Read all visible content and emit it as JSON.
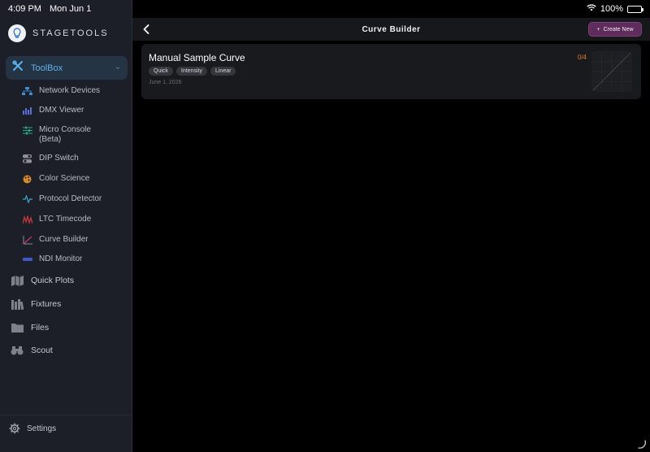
{
  "status": {
    "time": "4:09 PM",
    "date": "Mon Jun 1",
    "battery": "100%"
  },
  "brand": {
    "name": "STAGETOOLS"
  },
  "sidebar": {
    "toolbox": {
      "label": "ToolBox"
    },
    "subitems": [
      {
        "label": "Network Devices",
        "icon": "network-icon",
        "color": "#3a8fd6"
      },
      {
        "label": "DMX Viewer",
        "icon": "dmx-icon",
        "color": "#5b6fd6"
      },
      {
        "label": "Micro Console (Beta)",
        "icon": "sliders-icon",
        "color": "#2aa88a"
      },
      {
        "label": "DIP Switch",
        "icon": "dip-switch-icon",
        "color": "#8e8f95"
      },
      {
        "label": "Color Science",
        "icon": "palette-icon",
        "color": "#d8892b"
      },
      {
        "label": "Protocol Detector",
        "icon": "waveform-icon",
        "color": "#3fa6c8"
      },
      {
        "label": "LTC Timecode",
        "icon": "timecode-icon",
        "color": "#c43a3a"
      },
      {
        "label": "Curve Builder",
        "icon": "curve-icon",
        "color": "#c43a6b"
      },
      {
        "label": "NDI Monitor",
        "icon": "ndi-icon",
        "color": "#4057c9"
      }
    ],
    "main_items": [
      {
        "label": "Quick Plots",
        "icon": "map-icon"
      },
      {
        "label": "Fixtures",
        "icon": "books-icon"
      },
      {
        "label": "Files",
        "icon": "folder-icon"
      },
      {
        "label": "Scout",
        "icon": "binoculars-icon"
      }
    ],
    "settings": {
      "label": "Settings"
    }
  },
  "navbar": {
    "title": "Curve Builder",
    "create_label": "Create New"
  },
  "card": {
    "title": "Manual Sample Curve",
    "tags": [
      "Quick",
      "Intensity",
      "Linear"
    ],
    "date": "June 1, 2026",
    "count": "0/4"
  },
  "colors": {
    "accent": "#5fb0ee",
    "create_bg": "#5d2c5a",
    "count": "#e07a2b"
  }
}
